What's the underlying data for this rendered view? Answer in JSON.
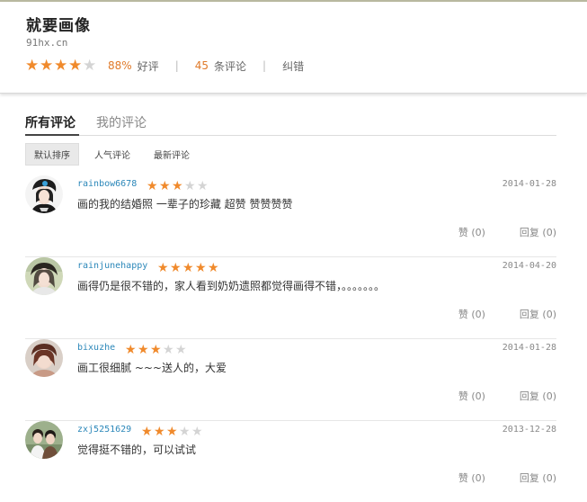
{
  "header": {
    "title": "就要画像",
    "domain": "91hx.cn",
    "rating_stars": 4,
    "good_rate": "88%",
    "good_rate_label": "好评",
    "review_count": "45",
    "review_count_label": "条评论",
    "report_label": "纠错",
    "separator": "|"
  },
  "tabs": [
    "所有评论",
    "我的评论"
  ],
  "sort_options": [
    "默认排序",
    "人气评论",
    "最新评论"
  ],
  "reviews": [
    {
      "user": "rainbow6678",
      "stars": 3,
      "date": "2014-01-28",
      "text": "画的我的结婚照 一辈子的珍藏 超赞 赞赞赞赞",
      "like": "赞 (0)",
      "reply": "回复 (0)"
    },
    {
      "user": "rainjunehappy",
      "stars": 5,
      "date": "2014-04-20",
      "text": "画得仍是很不错的，家人看到奶奶遗照都觉得画得不错，。。。。。。。",
      "like": "赞 (0)",
      "reply": "回复 (0)"
    },
    {
      "user": "bixuzhe",
      "stars": 3,
      "date": "2014-01-28",
      "text": "画工很细腻 ~~~送人的，大爱",
      "like": "赞 (0)",
      "reply": "回复 (0)"
    },
    {
      "user": "zxj5251629",
      "stars": 3,
      "date": "2013-12-28",
      "text": "觉得挺不错的，可以试试",
      "like": "赞 (0)",
      "reply": "回复 (0)"
    }
  ],
  "colors": {
    "star": "#f08a2c",
    "link": "#2b87b9",
    "accent": "#e07a2a"
  },
  "icons": {
    "star": "star-icon"
  }
}
